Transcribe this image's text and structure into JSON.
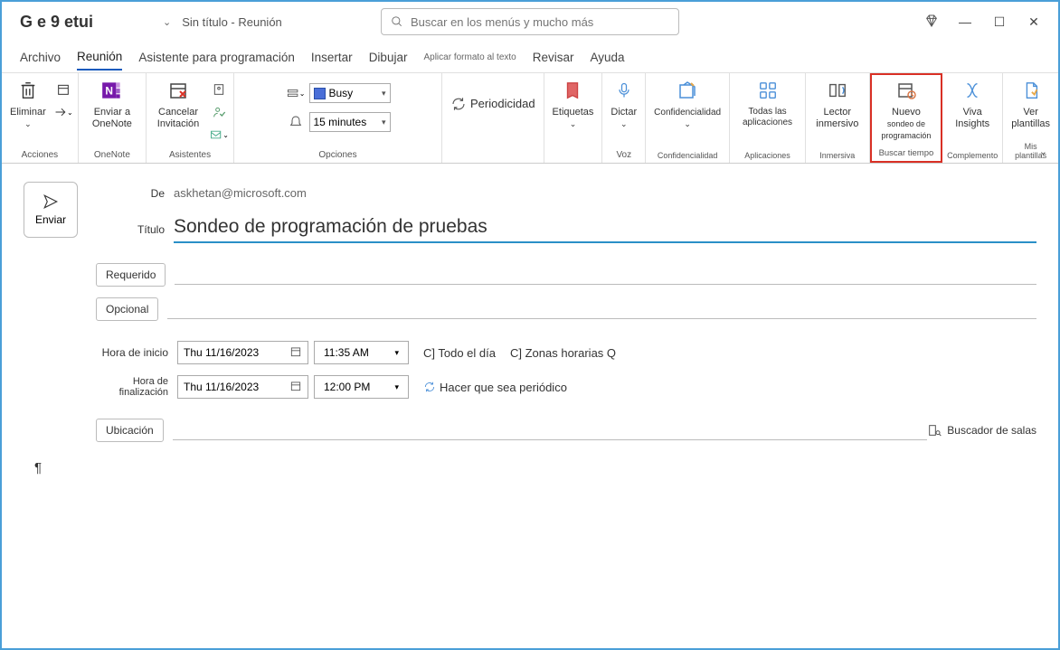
{
  "titlebar": {
    "app": "G e 9 etui",
    "doc": "Sin título  -  Reunión"
  },
  "search": {
    "placeholder": "Buscar en los menús y mucho más"
  },
  "tabs": {
    "archivo": "Archivo",
    "reunion": "Reunión",
    "asistente": "Asistente para programación",
    "insertar": "Insertar",
    "dibujar": "Dibujar",
    "formato": "Aplicar formato al texto",
    "revisar": "Revisar",
    "ayuda": "Ayuda"
  },
  "ribbon": {
    "eliminar": "Eliminar",
    "enviar_onenote": "Enviar a OneNote",
    "cancelar_inv": "Cancelar Invitación",
    "periodicidad": "Periodicidad",
    "busy": "Busy",
    "reminder": "15 minutes",
    "etiquetas": "Etiquetas",
    "dictar": "Dictar",
    "confidencialidad": "Confidencialidad",
    "todas_aplic": "Todas las aplicaciones",
    "lector": "Lector inmersivo",
    "nuevo_sondeo_1": "Nuevo",
    "nuevo_sondeo_2": "sondeo de programación",
    "viva": "Viva Insights",
    "ver_plantillas": "Ver plantillas",
    "grp_acciones": "Acciones",
    "grp_onenote": "OneNote",
    "grp_asistentes": "Asistentes",
    "grp_opciones": "Opciones",
    "grp_voz": "Voz",
    "grp_confidencialidad": "Confidencialidad",
    "grp_aplicaciones": "Aplicaciones",
    "grp_inmersiva": "Inmersiva",
    "grp_buscartiempo": "Buscar tiempo",
    "grp_complemento": "Complemento",
    "grp_plantillas": "Mis plantillas"
  },
  "form": {
    "enviar": "Enviar",
    "de": "De",
    "from_value": "askhetan@microsoft.com",
    "titulo": "Título",
    "title_value": "Sondeo de programación de pruebas",
    "requerido": "Requerido",
    "opcional": "Opcional",
    "hora_inicio": "Hora de inicio",
    "hora_fin": "Hora de finalización",
    "start_date": "Thu 11/16/2023",
    "start_time": "11:35 AM",
    "end_date": "Thu 11/16/2023",
    "end_time": "12:00 PM",
    "todo_dia": "C] Todo el día",
    "zonas": "C] Zonas horarias Q",
    "periodico": "Hacer que sea periódico",
    "ubicacion": "Ubicación",
    "buscador_salas": "Buscador de salas"
  }
}
